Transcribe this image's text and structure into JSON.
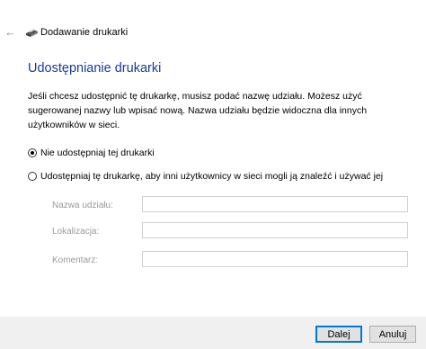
{
  "window": {
    "title": "Dodawanie drukarki",
    "back_icon": "back-arrow-icon",
    "printer_icon": "printer-icon"
  },
  "content": {
    "heading": "Udostępnianie drukarki",
    "description": "Jeśli chcesz udostępnić tę drukarkę, musisz podać nazwę udziału. Możesz użyć sugerowanej nazwy lub wpisać nową. Nazwa udziału będzie widoczna dla innych użytkowników w sieci.",
    "options": [
      {
        "label": "Nie udostępniaj tej drukarki",
        "selected": true
      },
      {
        "label": "Udostępniaj tę drukarkę, aby inni użytkownicy w sieci mogli ją znaleźć i używać jej",
        "selected": false
      }
    ],
    "fields": {
      "share_name": {
        "label": "Nazwa udziału:",
        "value": ""
      },
      "location": {
        "label": "Lokalizacja:",
        "value": ""
      },
      "comment": {
        "label": "Komentarz:",
        "value": ""
      }
    }
  },
  "buttons": {
    "next": "Dalej",
    "cancel": "Anuluj"
  },
  "colors": {
    "heading": "#1a3a9e",
    "footer_bg": "#f0f0f0",
    "primary_border": "#0078d7"
  }
}
